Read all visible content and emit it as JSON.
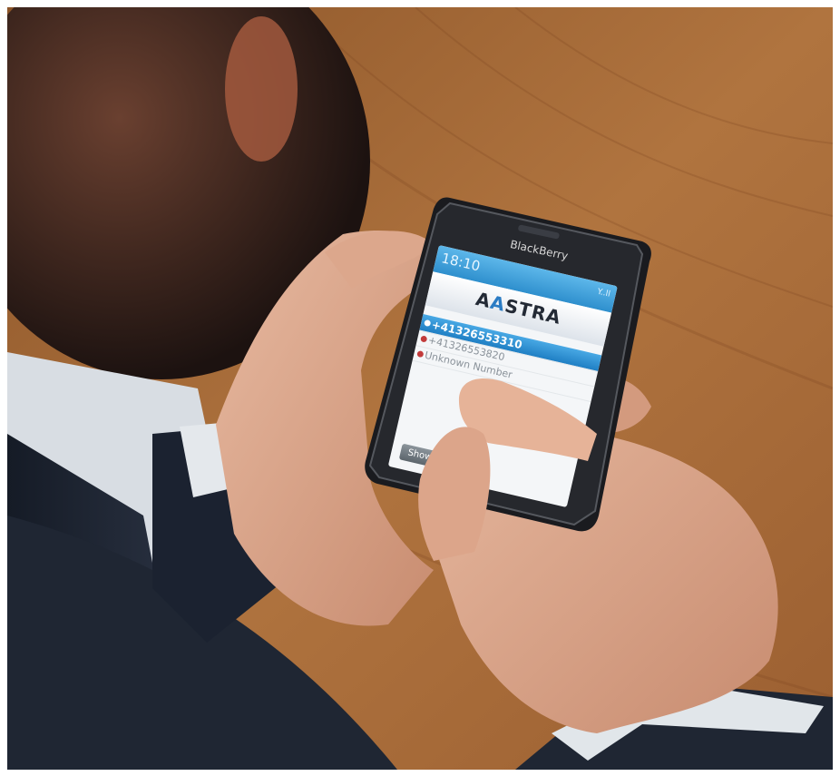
{
  "phone": {
    "brand": "BlackBerry",
    "status_time": "18:10",
    "signal": "Y..ll"
  },
  "app": {
    "logo_prefix": "A",
    "logo_accent": "A",
    "logo_suffix": "STRA",
    "calls": [
      {
        "number": "+41326553310",
        "selected": true
      },
      {
        "number": "+41326553820",
        "selected": false
      },
      {
        "number": "Unknown Number",
        "selected": false
      }
    ],
    "softkey_label": "Show Keyboard"
  },
  "colors": {
    "accent": "#2b7cc4",
    "wood": "#a8683a",
    "suit": "#1f2633"
  }
}
